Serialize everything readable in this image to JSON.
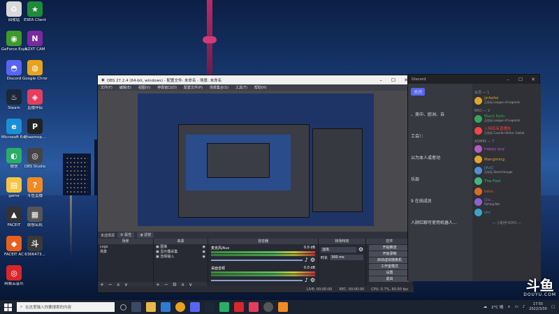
{
  "desktop_icons": [
    {
      "label": "回收站",
      "color": "#d9d9d9",
      "glyph": "♻"
    },
    {
      "label": "ESEA Client",
      "color": "#1f8a3b",
      "glyph": "★"
    },
    {
      "label": "GeForce Experience",
      "color": "#3f9a2a",
      "glyph": "◉"
    },
    {
      "label": "NZXT CAM",
      "color": "#7a2aa0",
      "glyph": "N"
    },
    {
      "label": "Discord",
      "color": "#5865f2",
      "glyph": "◓"
    },
    {
      "label": "Google Chrome",
      "color": "#e8a21c",
      "glyph": "◍"
    },
    {
      "label": "Steam",
      "color": "#1b2838",
      "glyph": "♨"
    },
    {
      "label": "直播伴侣",
      "color": "#e83c5f",
      "glyph": "◈"
    },
    {
      "label": "Microsoft Edge",
      "color": "#1b8fd6",
      "glyph": "e"
    },
    {
      "label": "Phasmop...",
      "color": "#222",
      "glyph": "P"
    },
    {
      "label": "微信",
      "color": "#2aae67",
      "glyph": "◐"
    },
    {
      "label": "OBS Studio",
      "color": "#444",
      "glyph": "◎"
    },
    {
      "label": "game",
      "color": "#f5c542",
      "glyph": "▤"
    },
    {
      "label": "斗鱼直播",
      "color": "#f08a24",
      "glyph": "?"
    },
    {
      "label": "FACEIT",
      "color": "#333",
      "glyph": "▲"
    },
    {
      "label": "联想名机",
      "color": "#555",
      "glyph": "▦"
    },
    {
      "label": "FACEIT AC",
      "color": "#e8611c",
      "glyph": "◆"
    },
    {
      "label": "6366473...",
      "color": "#3a3a3a",
      "glyph": "斗"
    },
    {
      "label": "网易云音乐",
      "color": "#d9262a",
      "glyph": "◎"
    }
  ],
  "obs": {
    "title": "OBS 27.2.4 (64-bit, windows) - 配置文件: 未命名 - 场景: 未命名",
    "menu": [
      "文件(F)",
      "编辑(E)",
      "视图(V)",
      "停靠窗口(D)",
      "配置文件(P)",
      "场景集合(S)",
      "工具(T)",
      "帮助(H)"
    ],
    "toolbar_label": "未选择源",
    "toolbar_props": "属性",
    "toolbar_filters": "滤镜",
    "docks": {
      "scenes": {
        "title": "场景",
        "items": [
          "csgo",
          "场景"
        ]
      },
      "sources": {
        "title": "来源",
        "items": [
          "图像",
          "显示器采集",
          "音频输入"
        ]
      },
      "mixer": {
        "title": "混音器",
        "tracks": [
          {
            "name": "麦克风/Aux",
            "db": "0.0 dB"
          },
          {
            "name": "桌面音频",
            "db": "0.0 dB"
          }
        ]
      },
      "transitions": {
        "title": "转场特效",
        "type": "淡出",
        "duration_label": "时长",
        "duration": "300 ms"
      },
      "controls": {
        "title": "控件",
        "buttons": [
          "开始推流",
          "开始录制",
          "启动虚拟摄像机",
          "工作室模式",
          "设置",
          "退出"
        ]
      }
    },
    "status": {
      "live": "LIVE: 00:00:00",
      "rec": "REC: 00:00:00",
      "cpu": "CPU: 0.7%, 60.00 fps"
    }
  },
  "discord": {
    "title": "Discord",
    "chat_lines": [
      "关闭",
      "、美中、欧洲、自",
      "工会）：",
      "以为本人或者动",
      "乐部",
      "9 在线成员",
      "人顾红聊可使用机器人..."
    ],
    "groups": [
      {
        "name": "会员 — 1",
        "members": [
          {
            "name": "jinfeifei",
            "status": "正在玩 League of Legends",
            "color": "#e0a52e"
          }
        ]
      },
      {
        "name": "BRO — 2",
        "members": [
          {
            "name": "Black Kylin",
            "status": "正在玩 League of Legends",
            "color": "#3aa55d"
          },
          {
            "name": "入网后有直播在",
            "status": "正在玩 Counter-Strike: Global",
            "color": "#f04747"
          }
        ]
      },
      {
        "name": "ADMIN — 7",
        "members": [
          {
            "name": "happy guy",
            "status": "",
            "color": "#b45cc4"
          },
          {
            "name": "Mangming",
            "status": "",
            "color": "#e0a52e"
          },
          {
            "name": "jifuQ",
            "status": "正在玩 Shred Hunger",
            "color": "#4f8fd6"
          },
          {
            "name": "The Fool",
            "status": "",
            "color": "#43b581"
          },
          {
            "name": "Intro",
            "status": "",
            "color": "#d96b2a"
          },
          {
            "name": "Qiu...",
            "status": "Fishing Bot",
            "color": "#8a63d2"
          },
          {
            "name": "chr",
            "status": "",
            "color": "#3aa5c9"
          }
        ]
      }
    ],
    "footer": "— 小助手YOYO —"
  },
  "taskbar": {
    "search_placeholder": "在这里输入你要搜索的内容",
    "weather": "2°C 晴",
    "time": "17:55",
    "date": "2022/3/30"
  },
  "watermark": {
    "big": "斗鱼",
    "small": "DOUYU.COM"
  }
}
